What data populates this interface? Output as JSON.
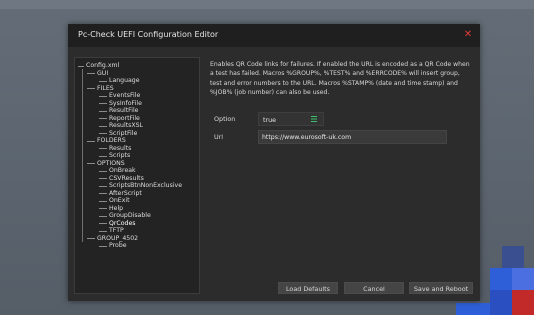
{
  "window": {
    "title": "Pc-Check UEFI Configuration Editor",
    "close_glyph": "✕"
  },
  "tree": {
    "items": [
      {
        "label": "Config.xml",
        "level": 0
      },
      {
        "label": "GUI",
        "level": 1
      },
      {
        "label": "Language",
        "level": 2
      },
      {
        "label": "FILES",
        "level": 1
      },
      {
        "label": "EventsFile",
        "level": 2
      },
      {
        "label": "SysInfoFile",
        "level": 2
      },
      {
        "label": "ResultFile",
        "level": 2
      },
      {
        "label": "ReportFile",
        "level": 2
      },
      {
        "label": "ResultsXSL",
        "level": 2
      },
      {
        "label": "ScriptFile",
        "level": 2
      },
      {
        "label": "FOLDERS",
        "level": 1
      },
      {
        "label": "Results",
        "level": 2
      },
      {
        "label": "Scripts",
        "level": 2
      },
      {
        "label": "OPTIONS",
        "level": 1
      },
      {
        "label": "OnBreak",
        "level": 2
      },
      {
        "label": "CSVResults",
        "level": 2
      },
      {
        "label": "ScriptsBtnNonExclusive",
        "level": 2
      },
      {
        "label": "AfterScript",
        "level": 2
      },
      {
        "label": "OnExit",
        "level": 2
      },
      {
        "label": "Help",
        "level": 2
      },
      {
        "label": "GroupDisable",
        "level": 2
      },
      {
        "label": "QrCodes",
        "level": 2,
        "selected": true
      },
      {
        "label": "TFTP",
        "level": 2
      },
      {
        "label": "GROUP_4502",
        "level": 1
      },
      {
        "label": "Probe",
        "level": 2
      }
    ]
  },
  "detail": {
    "description": "Enables QR Code links for failures. If enabled the URL is encoded as a QR Code when a test has failed. Macros %GROUP%, %TEST% and %ERRCODE% will insert group, test and error numbers to the URL. Macros %STAMP% (date and time stamp) and %JOB% (job number) can also be used.",
    "option_label": "Option",
    "option_value": "true",
    "option_icon": "menu-icon",
    "url_label": "Url",
    "url_value": "https://www.eurosoft-uk.com"
  },
  "buttons": {
    "load_defaults": "Load Defaults",
    "cancel": "Cancel",
    "save_reboot": "Save and Reboot"
  },
  "colors": {
    "accent_green": "#3bbf6a",
    "close_red": "#e03a3a",
    "tile_blue": "#2f5fd8",
    "tile_red": "#c22a2a"
  }
}
